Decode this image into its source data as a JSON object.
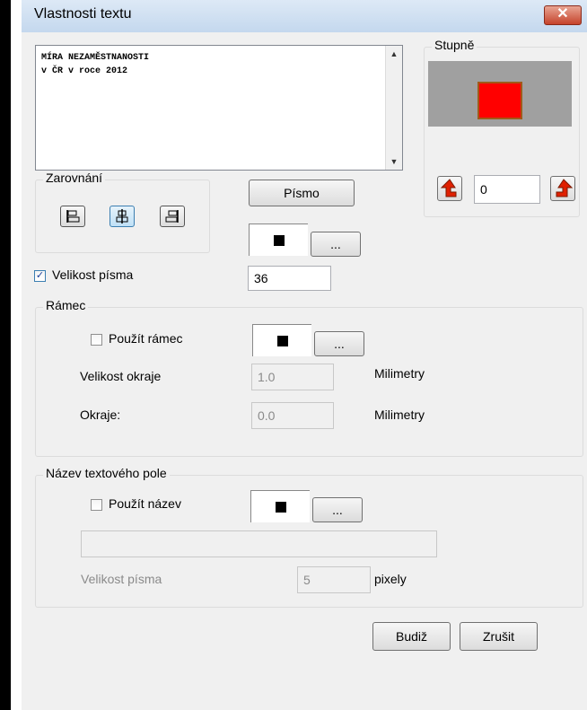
{
  "window": {
    "title": "Vlastnosti textu",
    "close_symbol": "✕"
  },
  "text_content": {
    "line1": "MÍRA NEZAMĚSTNANOSTI",
    "line2": "v ČR v roce 2012"
  },
  "rotation": {
    "group_label": "Stupně",
    "value": "0",
    "preview_color": "#ff0000",
    "preview_bg": "#a0a0a0"
  },
  "alignment": {
    "group_label": "Zarovnání"
  },
  "font": {
    "button_label": "Písmo",
    "color": "#000000",
    "more_label": "..."
  },
  "font_size": {
    "checkbox_label": "Velikost písma",
    "checked": true,
    "value": "36"
  },
  "frame": {
    "group_label": "Rámec",
    "use_label": "Použít rámec",
    "more_label": "...",
    "border_size_label": "Velikost okraje",
    "border_size_value": "1.0",
    "border_size_unit": "Milimetry",
    "margin_label": "Okraje:",
    "margin_value": "0.0",
    "margin_unit": "Milimetry"
  },
  "title_field": {
    "group_label": "Název textového pole",
    "use_label": "Použít název",
    "more_label": "...",
    "text_value": "",
    "size_label": "Velikost písma",
    "size_value": "5",
    "size_unit": "pixely"
  },
  "actions": {
    "ok_label": "Budiž",
    "cancel_label": "Zrušit"
  },
  "colors": {
    "accent_blue": "#3c7fb1",
    "arrow_red": "#e02000"
  }
}
